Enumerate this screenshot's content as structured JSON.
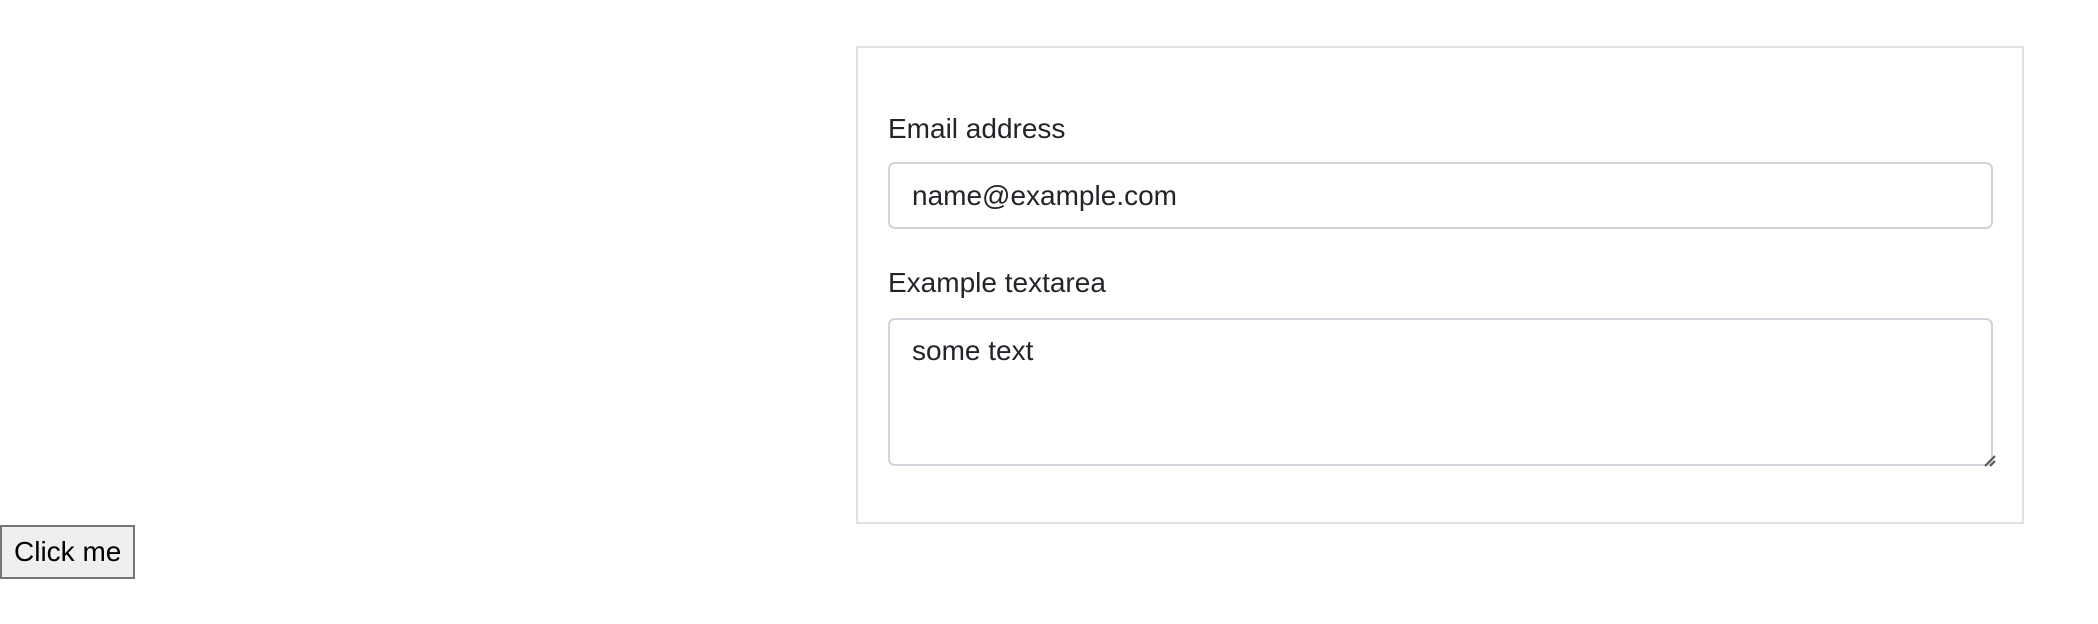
{
  "form": {
    "email": {
      "label": "Email address",
      "value": "name@example.com"
    },
    "textarea": {
      "label": "Example textarea",
      "value": "some text"
    }
  },
  "actions": {
    "click_me_label": "Click me"
  },
  "colors": {
    "card_border": "#dee2e6",
    "input_border": "#ced4da",
    "text": "#212529",
    "button_background": "#efefef",
    "button_border": "#767676"
  },
  "icons": {
    "textarea_resize": "resize-grip-icon"
  }
}
